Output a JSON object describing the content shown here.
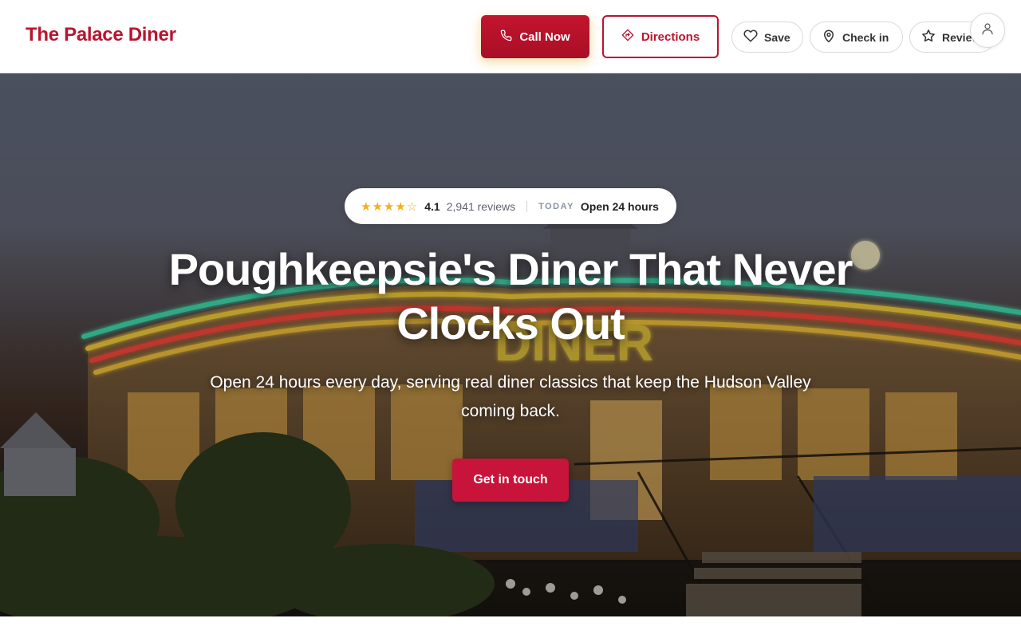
{
  "header": {
    "brand": "The Palace Diner",
    "call_label": "Call Now",
    "directions_label": "Directions",
    "save_label": "Save",
    "checkin_label": "Check in",
    "review_label": "Review",
    "icons": {
      "call": "phone-icon",
      "directions": "directions-icon",
      "save": "heart-icon",
      "checkin": "map-pin-icon",
      "review": "star-icon",
      "account": "user-icon"
    }
  },
  "hero": {
    "rating": {
      "stars": "★★★★☆",
      "stars_value": 4.1,
      "value": "4.1",
      "reviews": "2,941 reviews",
      "today_label": "TODAY",
      "hours": "Open 24 hours"
    },
    "title": "Poughkeepsie's Diner That Never Clocks Out",
    "subtitle": "Open 24 hours every day, serving real diner classics that keep the Hudson Valley coming back.",
    "cta_label": "Get in touch",
    "sign_text": "DINER"
  },
  "colors": {
    "brand": "#b8152f",
    "cta": "#c8143a",
    "star": "#f2b01e"
  }
}
